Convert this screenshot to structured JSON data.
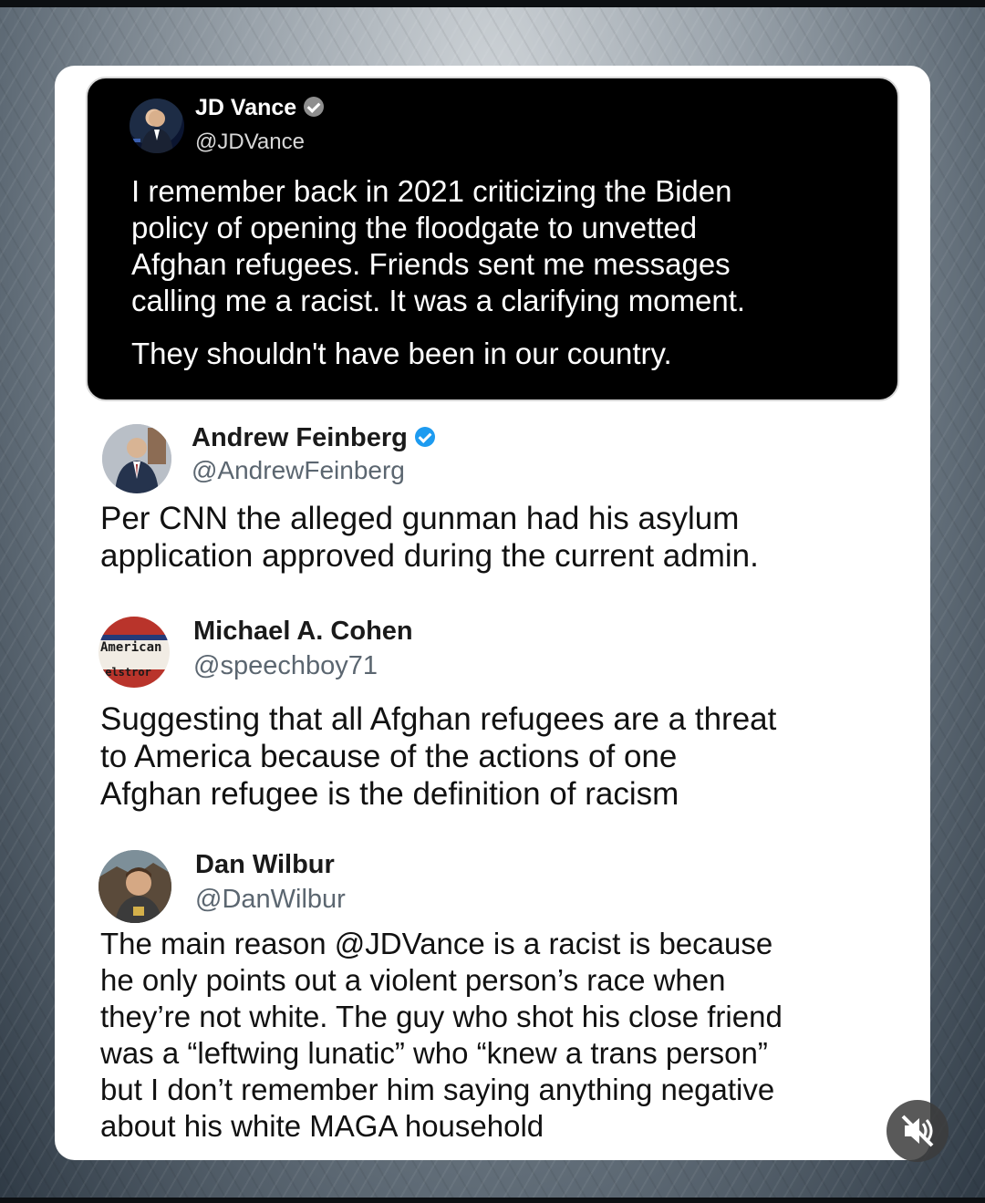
{
  "tweets": [
    {
      "name": "JD Vance",
      "handle": "@JDVance",
      "text": "I remember back in 2021 criticizing the Biden\npolicy of opening the floodgate to unvetted\nAfghan refugees. Friends sent me messages\ncalling me a racist. It was a clarifying moment.",
      "text2": "They shouldn't have been in our country.",
      "verified_color": "#8e8e8e"
    },
    {
      "name": "Andrew Feinberg",
      "handle": "@AndrewFeinberg",
      "text": "Per CNN the alleged gunman had his asylum\napplication approved during the current admin.",
      "verified_color": "#1d9bf0"
    },
    {
      "name": "Michael A. Cohen",
      "handle": "@speechboy71",
      "avatar_text_top": "American",
      "avatar_text_bottom": "aelstror",
      "text": "Suggesting that all Afghan refugees are a threat\nto America because of the actions of one\nAfghan refugee is the definition of racism"
    },
    {
      "name": "Dan Wilbur",
      "handle": "@DanWilbur",
      "text": "The main reason @JDVance is a racist is because\nhe only points out a violent person’s race when\nthey’re not white. The guy who shot his close friend\nwas a “leftwing lunatic” who “knew a trans person”\nbut I don’t remember him saying anything negative\nabout his white MAGA household"
    }
  ],
  "controls": {
    "mute_icon": "speaker-muted-icon"
  }
}
